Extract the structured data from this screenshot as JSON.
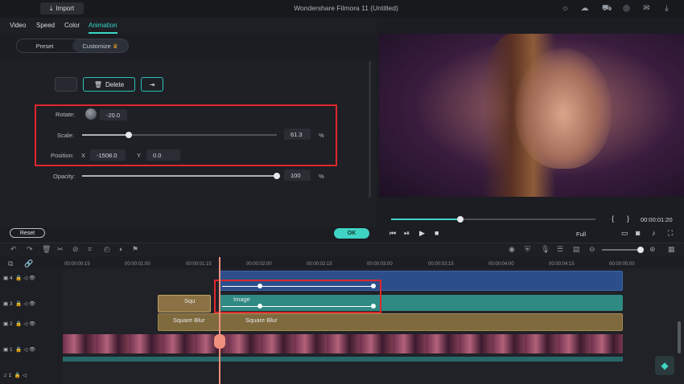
{
  "titlebar": {
    "import_label": "Import",
    "window_title": "Wondershare Filmora 11 (Untitled)"
  },
  "tabs": [
    "Video",
    "Speed",
    "Color",
    "Animation"
  ],
  "segment": {
    "preset": "Preset",
    "customize": "Customize"
  },
  "keyframe": {
    "delete_label": "Delete"
  },
  "props": {
    "rotate_label": "Rotate:",
    "rotate_value": "-20.0",
    "scale_label": "Scale:",
    "scale_value": "61.3",
    "scale_unit": "%",
    "scale_fraction": 0.24,
    "position_label": "Position:",
    "x_label": "X",
    "x_value": "-1508.0",
    "y_label": "Y",
    "y_value": "0.0",
    "opacity_label": "Opacity:",
    "opacity_value": "100",
    "opacity_unit": "%",
    "opacity_fraction": 1.0
  },
  "footer": {
    "reset_label": "Reset",
    "ok_label": "OK"
  },
  "player": {
    "time": "00:00:01:20",
    "quality": "Full",
    "progress_fraction": 0.34
  },
  "ruler": [
    "00:00:00:15",
    "00:00:01:00",
    "00:00:01:15",
    "00:00:02:00",
    "00:00:02:15",
    "00:00:03:00",
    "00:00:03:15",
    "00:00:04:00",
    "00:00:04:15",
    "00:00:05:00"
  ],
  "tracks": [
    {
      "label": "4"
    },
    {
      "label": "3"
    },
    {
      "label": "2"
    },
    {
      "label": "1"
    },
    {
      "label": "1"
    }
  ],
  "clips": {
    "image_label": "Image",
    "blur_label": "Square Blur",
    "blur_label2": "Square Blur",
    "small_label": "Squ"
  },
  "colors": {
    "accent": "#3fd3c3",
    "highlight": "#e0262b"
  }
}
